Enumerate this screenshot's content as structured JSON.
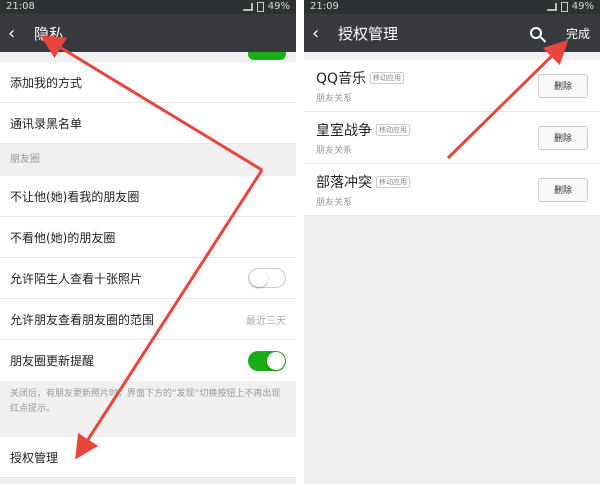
{
  "left": {
    "status": {
      "time": "21:08",
      "battery": "49%"
    },
    "title": "隐私",
    "rows_top": [
      "添加我的方式",
      "通讯录黑名单"
    ],
    "section": "朋友圈",
    "moments": {
      "row1": "不让他(她)看我的朋友圈",
      "row2": "不看他(她)的朋友圈",
      "row3": "允许陌生人查看十张照片",
      "row4": "允许朋友查看朋友圈的范围",
      "row4_value": "最近三天",
      "row5": "朋友圈更新提醒"
    },
    "note": "关闭后，有朋友更新照片时，界面下方的“发现”切换按钮上不再出现红点提示。",
    "auth": "授权管理"
  },
  "right": {
    "status": {
      "time": "21:09",
      "battery": "49%"
    },
    "title": "授权管理",
    "done": "完成",
    "apps": [
      {
        "name": "QQ音乐",
        "tag": "移动应用",
        "sub": "朋友关系",
        "action": "删除"
      },
      {
        "name": "皇室战争",
        "tag": "移动应用",
        "sub": "朋友关系",
        "action": "删除"
      },
      {
        "name": "部落冲突",
        "tag": "移动应用",
        "sub": "朋友关系",
        "action": "删除"
      }
    ]
  },
  "toggles": {
    "stranger_photos": false,
    "moments_update": true
  },
  "colors": {
    "title_bar": "#393a3f",
    "status_bar": "#2e3132",
    "toggle_on": "#1aad19",
    "arrow": "#e8453c"
  }
}
